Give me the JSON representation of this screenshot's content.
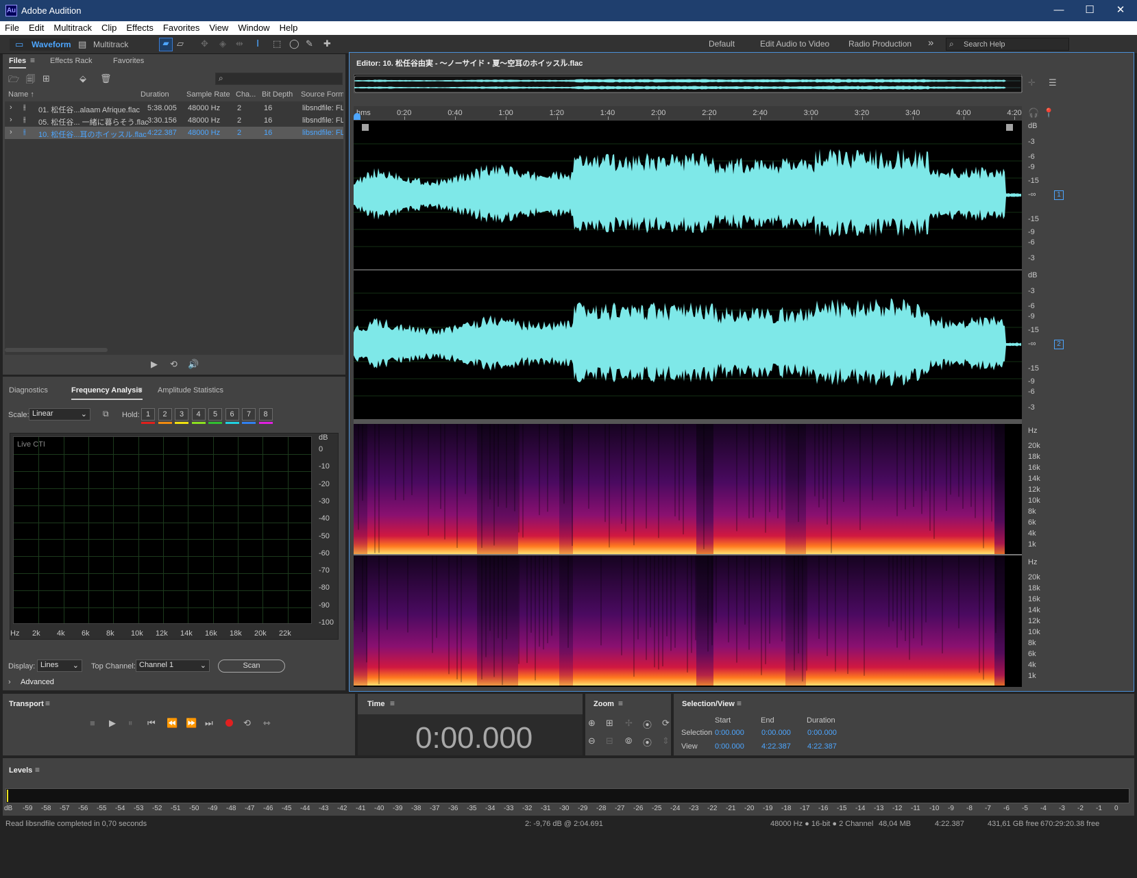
{
  "app": {
    "title": "Adobe Audition",
    "logo": "Au"
  },
  "menu": [
    "File",
    "Edit",
    "Multitrack",
    "Clip",
    "Effects",
    "Favorites",
    "View",
    "Window",
    "Help"
  ],
  "toolbar": {
    "waveform_label": "Waveform",
    "multitrack_label": "Multitrack",
    "workspaces": [
      "Default",
      "Edit Audio to Video",
      "Radio Production"
    ],
    "more": "»",
    "search_placeholder": "Search Help"
  },
  "files_panel": {
    "tabs": [
      "Files",
      "Effects Rack",
      "Favorites"
    ],
    "columns": [
      "Name ↑",
      "Duration",
      "Sample Rate",
      "Cha...",
      "Bit Depth",
      "Source Format"
    ],
    "rows": [
      {
        "name": "01. 松任谷...alaam Afrique.flac",
        "duration": "5:38.005",
        "rate": "48000 Hz",
        "ch": "2",
        "bits": "16",
        "format": "libsndfile: FL"
      },
      {
        "name": "05. 松任谷... 一緒に暮らそう.flac",
        "duration": "3:30.156",
        "rate": "48000 Hz",
        "ch": "2",
        "bits": "16",
        "format": "libsndfile: FL"
      },
      {
        "name": "10. 松任谷...耳のホイッスル.flac",
        "duration": "4:22.387",
        "rate": "48000 Hz",
        "ch": "2",
        "bits": "16",
        "format": "libsndfile: FL"
      }
    ]
  },
  "analysis": {
    "tabs": [
      "Diagnostics",
      "Frequency Analysis",
      "Amplitude Statistics"
    ],
    "scale_label": "Scale:",
    "scale_value": "Linear",
    "hold_label": "Hold:",
    "holds": [
      "1",
      "2",
      "3",
      "4",
      "5",
      "6",
      "7",
      "8"
    ],
    "hold_colors": [
      "#e0201c",
      "#f08a10",
      "#f0e010",
      "#8ce020",
      "#30c030",
      "#20d0e0",
      "#3080f0",
      "#e020e0"
    ],
    "graph_label": "Live CTI",
    "db_ticks": [
      "dB",
      "0",
      "-10",
      "-20",
      "-30",
      "-40",
      "-50",
      "-60",
      "-70",
      "-80",
      "-90",
      "-100"
    ],
    "hz_ticks": [
      "Hz",
      "2k",
      "4k",
      "6k",
      "8k",
      "10k",
      "12k",
      "14k",
      "16k",
      "18k",
      "20k",
      "22k"
    ],
    "display_label": "Display:",
    "display_value": "Lines",
    "top_channel_label": "Top Channel:",
    "top_channel_value": "Channel 1",
    "scan_label": "Scan",
    "advanced_label": "Advanced"
  },
  "editor": {
    "title": "Editor: 10. 松任谷由実 - 〜ノーサイド・夏〜空耳のホイッスル.flac",
    "time_ticks": [
      "hms",
      "0:20",
      "0:40",
      "1:00",
      "1:20",
      "1:40",
      "2:00",
      "2:20",
      "2:40",
      "3:00",
      "3:20",
      "3:40",
      "4:00",
      "4:20"
    ],
    "db_scale": [
      "dB",
      "-3",
      "-6",
      "-9",
      "-15",
      "-∞",
      "-15",
      "-9",
      "-6",
      "-3"
    ],
    "hz_scale": [
      "Hz",
      "20k",
      "18k",
      "16k",
      "14k",
      "12k",
      "10k",
      "8k",
      "6k",
      "4k",
      "1k"
    ],
    "ch1": "1",
    "ch2": "2",
    "wave_color": "#7ee8e8"
  },
  "transport": {
    "title": "Transport"
  },
  "time": {
    "title": "Time",
    "value": "0:00.000"
  },
  "zoom": {
    "title": "Zoom"
  },
  "selview": {
    "title": "Selection/View",
    "cols": [
      "Start",
      "End",
      "Duration"
    ],
    "selection_label": "Selection",
    "view_label": "View",
    "selection": [
      "0:00.000",
      "0:00.000",
      "0:00.000"
    ],
    "view": [
      "0:00.000",
      "4:22.387",
      "4:22.387"
    ]
  },
  "levels": {
    "title": "Levels",
    "ticks": [
      "dB",
      "-59",
      "-58",
      "-57",
      "-56",
      "-55",
      "-54",
      "-53",
      "-52",
      "-51",
      "-50",
      "-49",
      "-48",
      "-47",
      "-46",
      "-45",
      "-44",
      "-43",
      "-42",
      "-41",
      "-40",
      "-39",
      "-38",
      "-37",
      "-36",
      "-35",
      "-34",
      "-33",
      "-32",
      "-31",
      "-30",
      "-29",
      "-28",
      "-27",
      "-26",
      "-25",
      "-24",
      "-23",
      "-22",
      "-21",
      "-20",
      "-19",
      "-18",
      "-17",
      "-16",
      "-15",
      "-14",
      "-13",
      "-12",
      "-11",
      "-10",
      "-9",
      "-8",
      "-7",
      "-6",
      "-5",
      "-4",
      "-3",
      "-2",
      "-1",
      "0"
    ]
  },
  "status": {
    "left": "Read libsndfile completed in 0,70 seconds",
    "cursor": "2: -9,76 dB @ 2:04.691",
    "format": "48000 Hz ● 16-bit ● 2 Channel",
    "size": "48,04 MB",
    "duration": "4:22.387",
    "free": "431,61 GB free",
    "free_time": "670:29:20.38 free"
  }
}
